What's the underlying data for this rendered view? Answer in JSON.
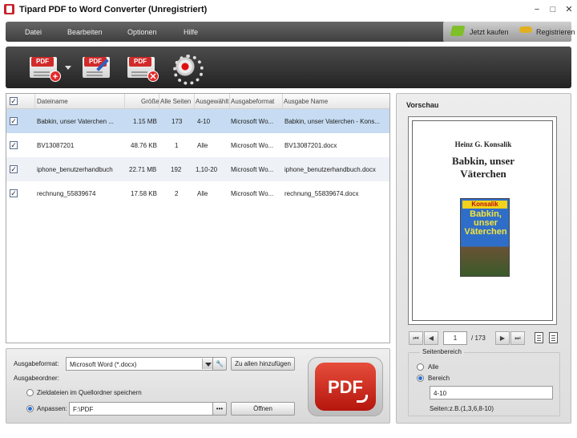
{
  "window": {
    "title": "Tipard PDF to Word Converter (Unregistriert)",
    "minimize": "−",
    "maximize": "□",
    "close": "✕"
  },
  "menu": {
    "items": [
      "Datei",
      "Bearbeiten",
      "Optionen",
      "Hilfe"
    ],
    "buy": "Jetzt kaufen",
    "register": "Registrieren"
  },
  "toolbar": {
    "add_tag": "PDF",
    "edit_tag": "PDF",
    "remove_tag": "PDF",
    "add_badge": "+",
    "remove_badge": "✕"
  },
  "table": {
    "headers": [
      "Dateiname",
      "Größe",
      "Alle Seiten",
      "Ausgewählt",
      "Ausgabeformat",
      "Ausgabe Name"
    ],
    "rows": [
      {
        "checked": "✓",
        "name": "Babkin, unser Vaterchen ...",
        "size": "1.15 MB",
        "pages": "173",
        "selected": "4-10",
        "format": "Microsoft Wo...",
        "output": "Babkin, unser Vaterchen - Kons..."
      },
      {
        "checked": "✓",
        "name": "BV13087201",
        "size": "48.76 KB",
        "pages": "1",
        "selected": "Alle",
        "format": "Microsoft Wo...",
        "output": "BV13087201.docx"
      },
      {
        "checked": "✓",
        "name": "iphone_benutzerhandbuch",
        "size": "22.71 MB",
        "pages": "192",
        "selected": "1,10-20",
        "format": "Microsoft Wo...",
        "output": "iphone_benutzerhandbuch.docx"
      },
      {
        "checked": "✓",
        "name": "rechnung_55839674",
        "size": "17.58 KB",
        "pages": "2",
        "selected": "Alle",
        "format": "Microsoft Wo...",
        "output": "rechnung_55839674.docx"
      }
    ]
  },
  "options": {
    "format_label": "Ausgabeformat:",
    "format_value": "Microsoft Word (*.docx)",
    "apply_all": "Zu allen hinzufügen",
    "folder_label": "Ausgabeordner:",
    "source_folder": "Zieldateien im Quellordner speichern",
    "custom_label": "Anpassen:",
    "custom_path": "F:\\PDF",
    "browse": "•••",
    "open": "Öffnen",
    "convert": "PDF"
  },
  "preview": {
    "title": "Vorschau",
    "author": "Heinz G. Konsalik",
    "book_title_line1": "Babkin, unser",
    "book_title_line2": "Väterchen",
    "cover_brand": "Konsalik",
    "cover_title": "Babkin, unser Väterchen",
    "current_page": "1",
    "total_pages": "/ 173",
    "range_title": "Seitenbereich",
    "range_all": "Alle",
    "range_custom": "Bereich",
    "range_value": "4-10",
    "range_hint": "Seiten:z.B.(1,3,6,8-10)"
  }
}
